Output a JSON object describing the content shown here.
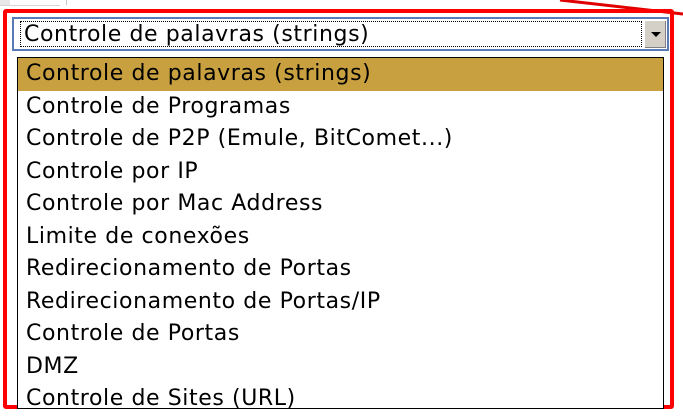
{
  "select": {
    "value": "Controle de palavras (strings)"
  },
  "options": [
    {
      "label": "Controle de palavras (strings)",
      "selected": true
    },
    {
      "label": "Controle de Programas",
      "selected": false
    },
    {
      "label": "Controle de P2P (Emule, BitComet...)",
      "selected": false
    },
    {
      "label": "Controle por IP",
      "selected": false
    },
    {
      "label": "Controle por Mac Address",
      "selected": false
    },
    {
      "label": "Limite de conexões",
      "selected": false
    },
    {
      "label": "Redirecionamento de Portas",
      "selected": false
    },
    {
      "label": "Redirecionamento de Portas/IP",
      "selected": false
    },
    {
      "label": "Controle de Portas",
      "selected": false
    },
    {
      "label": "DMZ",
      "selected": false
    },
    {
      "label": "Controle de Sites (URL)",
      "selected": false
    }
  ],
  "colors": {
    "highlight_frame": "#ff0000",
    "selected_option_bg": "#c8a040",
    "select_border": "#5a7ab5"
  },
  "icons": {
    "dropdown_arrow": "chevron-down-icon"
  }
}
